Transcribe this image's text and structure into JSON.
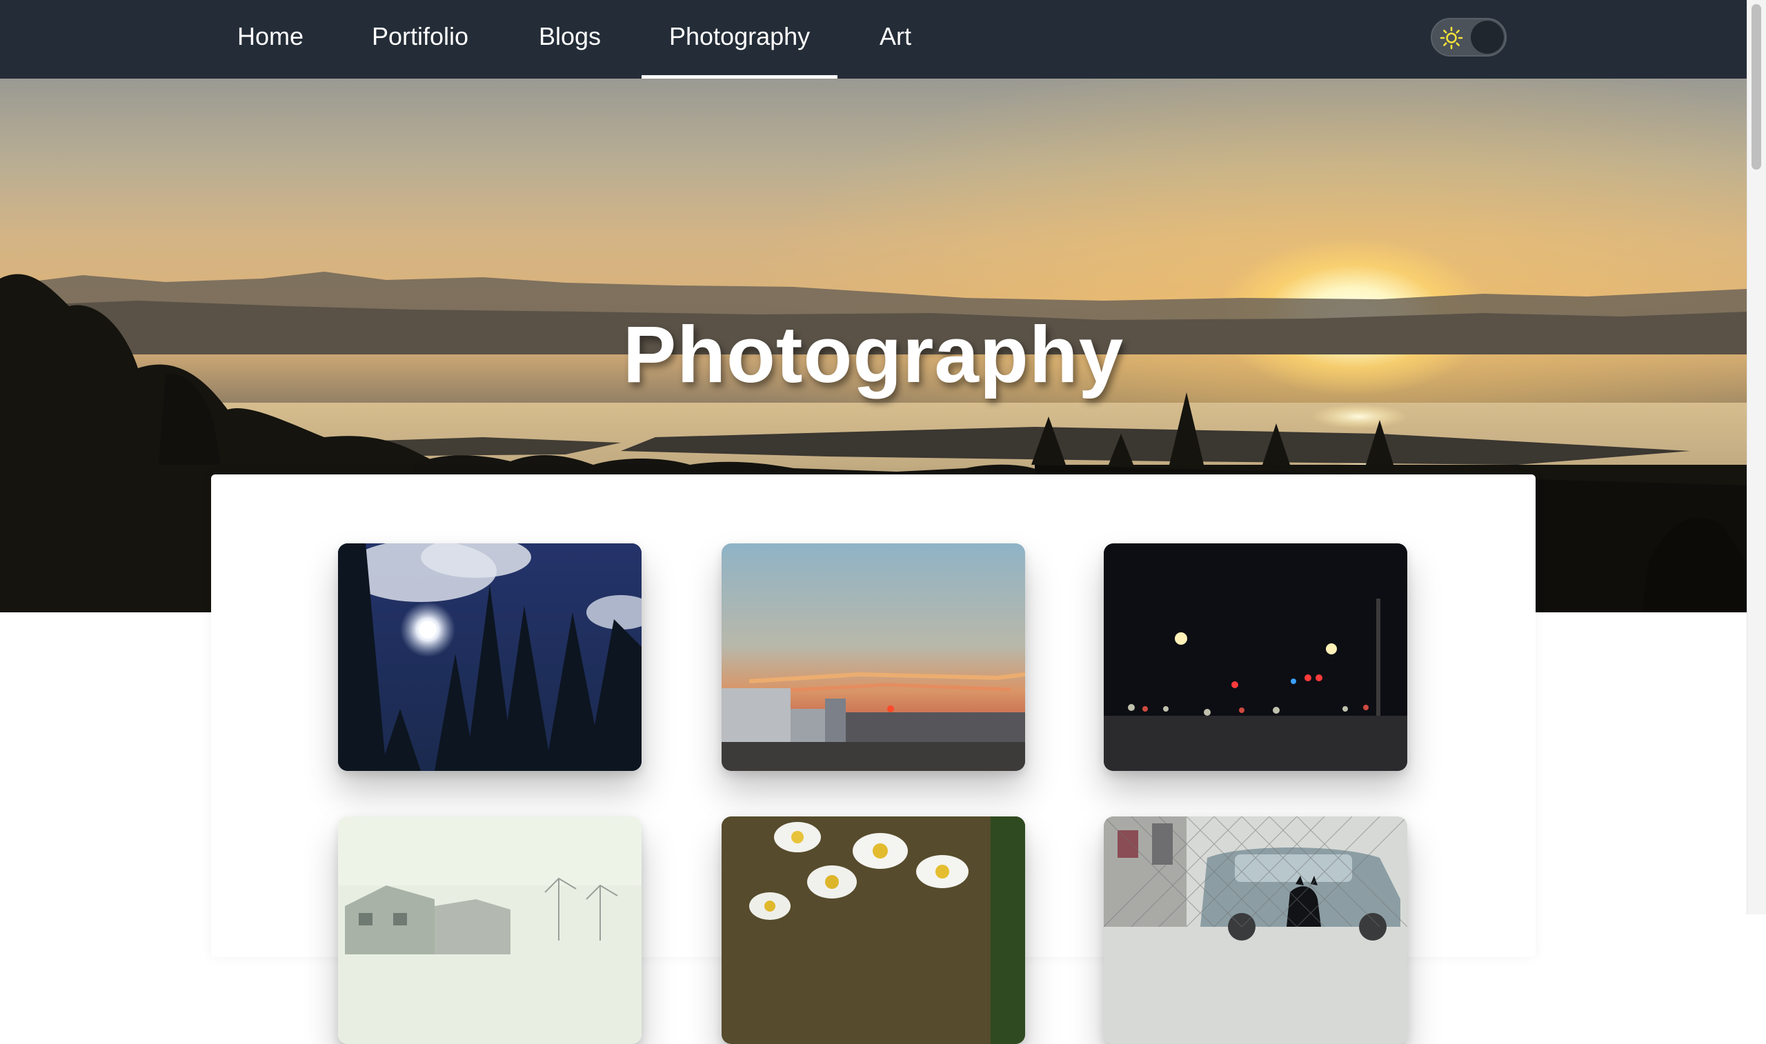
{
  "nav": {
    "items": [
      {
        "label": "Home"
      },
      {
        "label": "Portifolio"
      },
      {
        "label": "Blogs"
      },
      {
        "label": "Photography",
        "active": true
      },
      {
        "label": "Art"
      }
    ],
    "theme_toggle": {
      "icon": "sun-icon",
      "state": "light"
    }
  },
  "hero": {
    "title": "Photography"
  },
  "gallery": {
    "photos": [
      {
        "subject": "moon-over-pines"
      },
      {
        "subject": "city-sunset"
      },
      {
        "subject": "night-street-lights"
      },
      {
        "subject": "snowy-house"
      },
      {
        "subject": "daisies"
      },
      {
        "subject": "dog-by-car"
      }
    ]
  },
  "colors": {
    "navbar": "#242d37",
    "nav_text": "#ffffff",
    "sun_icon": "#f4e13a",
    "page_background": "#ffffff"
  }
}
